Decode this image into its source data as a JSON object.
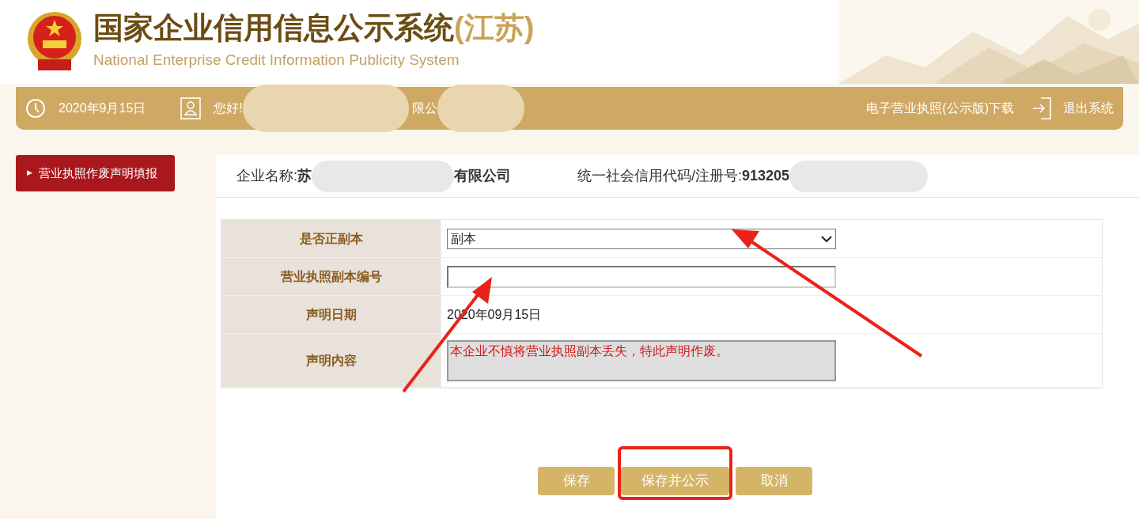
{
  "header": {
    "title": "国家企业信用信息公示系统",
    "title_suffix": "(江苏)",
    "subtitle": "National Enterprise Credit Information Publicity System"
  },
  "topbar": {
    "date": "2020年9月15日",
    "greeting": "您好!",
    "greeting_tail": "限公",
    "download_link": "电子营业执照(公示版)下载",
    "logout": "退出系统"
  },
  "sidebar": {
    "items": [
      {
        "marker": "▶",
        "label": "营业执照作废声明填报",
        "selected": true
      }
    ]
  },
  "company": {
    "name_label": "企业名称:",
    "name_start": "苏",
    "name_end": "有限公司",
    "code_label": "统一社会信用代码/注册号:",
    "code_start": "913205"
  },
  "form": {
    "rows": [
      {
        "kind": "select",
        "label": "是否正副本",
        "value": "副本"
      },
      {
        "kind": "input",
        "label": "营业执照副本编号"
      },
      {
        "kind": "text",
        "label": "声明日期",
        "value": "2020年09月15日"
      },
      {
        "kind": "textarea",
        "label": "声明内容",
        "value": "本企业不慎将营业执照副本丢失，特此声明作废。"
      }
    ]
  },
  "buttons": [
    {
      "label": "保存",
      "highlighted": false
    },
    {
      "label": "保存并公示",
      "highlighted": true
    },
    {
      "label": "取消",
      "highlighted": false
    }
  ]
}
